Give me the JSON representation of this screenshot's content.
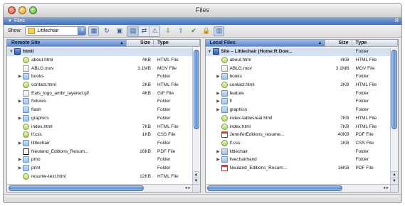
{
  "window": {
    "title": "Files"
  },
  "panel": {
    "title": "Files",
    "right_marker": "R"
  },
  "toolbar": {
    "show_label": "Show:",
    "site_name": "Littlechair",
    "icons": [
      "site-map-icon",
      "refresh-icon",
      "file-activity-icon",
      "expand-icon",
      "local-view-icon",
      "remote-view-icon",
      "get-icon",
      "put-icon",
      "check-out-icon",
      "check-in-icon",
      "site-expand-icon"
    ]
  },
  "remote": {
    "header": {
      "name": "Remote Site",
      "size": "Size",
      "type": "Type"
    },
    "rows": [
      {
        "name": "html/",
        "size": "",
        "type": "",
        "icon": "site",
        "level": 0,
        "expanded": true,
        "selected": true
      },
      {
        "name": "about.html",
        "size": "4KB",
        "type": "HTML File",
        "icon": "html",
        "level": 1
      },
      {
        "name": "ABLG.mov",
        "size": "3.1MB",
        "type": "MOV File",
        "icon": "gif",
        "level": 1
      },
      {
        "name": "books",
        "size": "",
        "type": "Folder",
        "icon": "folder",
        "level": 1,
        "collapsed": true
      },
      {
        "name": "contact.html",
        "size": "2KB",
        "type": "HTML File",
        "icon": "html",
        "level": 1
      },
      {
        "name": "Eats_logo_ambr_layered.gif",
        "size": "4KB",
        "type": "GIF File",
        "icon": "gif",
        "level": 1
      },
      {
        "name": "fixtures",
        "size": "",
        "type": "Folder",
        "icon": "folder",
        "level": 1,
        "collapsed": true
      },
      {
        "name": "flash",
        "size": "",
        "type": "Folder",
        "icon": "folder",
        "level": 1
      },
      {
        "name": "graphics",
        "size": "",
        "type": "Folder",
        "icon": "folder",
        "level": 1,
        "collapsed": true
      },
      {
        "name": "index.html",
        "size": "7KB",
        "type": "HTML File",
        "icon": "html",
        "level": 1
      },
      {
        "name": "lf.css",
        "size": "1KB",
        "type": "CSS File",
        "icon": "css",
        "level": 1
      },
      {
        "name": "littlechair",
        "size": "",
        "type": "Folder",
        "icon": "folder",
        "level": 1,
        "collapsed": true
      },
      {
        "name": "Neuland_Editions_Resum...",
        "size": "16KB",
        "type": "PDF File",
        "icon": "doc",
        "level": 1
      },
      {
        "name": "pmo",
        "size": "",
        "type": "Folder",
        "icon": "folder",
        "level": 1,
        "collapsed": true
      },
      {
        "name": "print",
        "size": "",
        "type": "Folder",
        "icon": "folder",
        "level": 1,
        "collapsed": true
      },
      {
        "name": "resume-text.html",
        "size": "12KB",
        "type": "HTML File",
        "icon": "html",
        "level": 1
      }
    ]
  },
  "local": {
    "header": {
      "name": "Local Files",
      "size": "Size",
      "type": "Type"
    },
    "rows": [
      {
        "name": "Site – Littlechair (Home:R:Dow...",
        "size": "",
        "type": "Folder",
        "icon": "site",
        "level": 0,
        "expanded": true,
        "selected": true
      },
      {
        "name": "about.html",
        "size": "4KB",
        "type": "HTML File",
        "icon": "html",
        "level": 1
      },
      {
        "name": "ABLG.mov",
        "size": "3.1MB",
        "type": "MOV File",
        "icon": "gif",
        "level": 1
      },
      {
        "name": "books",
        "size": "",
        "type": "Folder",
        "icon": "folder",
        "level": 1,
        "collapsed": true
      },
      {
        "name": "contact.html",
        "size": "2KB",
        "type": "HTML File",
        "icon": "html",
        "level": 1
      },
      {
        "name": "feature",
        "size": "",
        "type": "Folder",
        "icon": "folder",
        "level": 1,
        "collapsed": true
      },
      {
        "name": "fl",
        "size": "",
        "type": "Folder",
        "icon": "folder",
        "level": 1,
        "collapsed": true
      },
      {
        "name": "graphics",
        "size": "",
        "type": "Folder",
        "icon": "folder",
        "level": 1,
        "collapsed": true
      },
      {
        "name": "index-tablesreal.html",
        "size": "7KB",
        "type": "HTML File",
        "icon": "html",
        "level": 1
      },
      {
        "name": "index.html",
        "size": "7KB",
        "type": "HTML File",
        "icon": "html",
        "level": 1
      },
      {
        "name": "JenniferEditions_resume...",
        "size": "40KB",
        "type": "PDF File",
        "icon": "pdf",
        "level": 1
      },
      {
        "name": "lf.css",
        "size": "1KB",
        "type": "CSS File",
        "icon": "css",
        "level": 1
      },
      {
        "name": "littlechair",
        "size": "",
        "type": "Folder",
        "icon": "folder",
        "level": 1,
        "collapsed": true
      },
      {
        "name": "livechairhand",
        "size": "",
        "type": "Folder",
        "icon": "folder",
        "level": 1,
        "collapsed": true
      },
      {
        "name": "Neuland_Editions_Resum...",
        "size": "16KB",
        "type": "PDF File",
        "icon": "pdf",
        "level": 1
      }
    ]
  }
}
